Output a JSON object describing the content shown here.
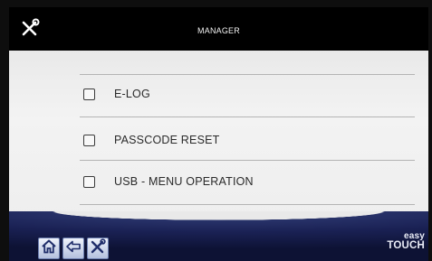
{
  "header": {
    "title": "MANAGER",
    "tool_icon": "tools-icon"
  },
  "menu": {
    "items": [
      {
        "label": "E-LOG",
        "checked": false
      },
      {
        "label": "PASSCODE RESET",
        "checked": false
      },
      {
        "label": "USB - MENU OPERATION",
        "checked": false
      }
    ]
  },
  "footer": {
    "buttons": [
      {
        "name": "home",
        "icon": "home-icon"
      },
      {
        "name": "back",
        "icon": "arrow-left-icon"
      },
      {
        "name": "tools",
        "icon": "tools-icon"
      }
    ],
    "brand_line1": "easy",
    "brand_line2": "TOUCH"
  },
  "colors": {
    "header_bg": "#000000",
    "content_bg": "#ececec",
    "footer_bg": "#1a2154",
    "text": "#2a2a2a"
  }
}
